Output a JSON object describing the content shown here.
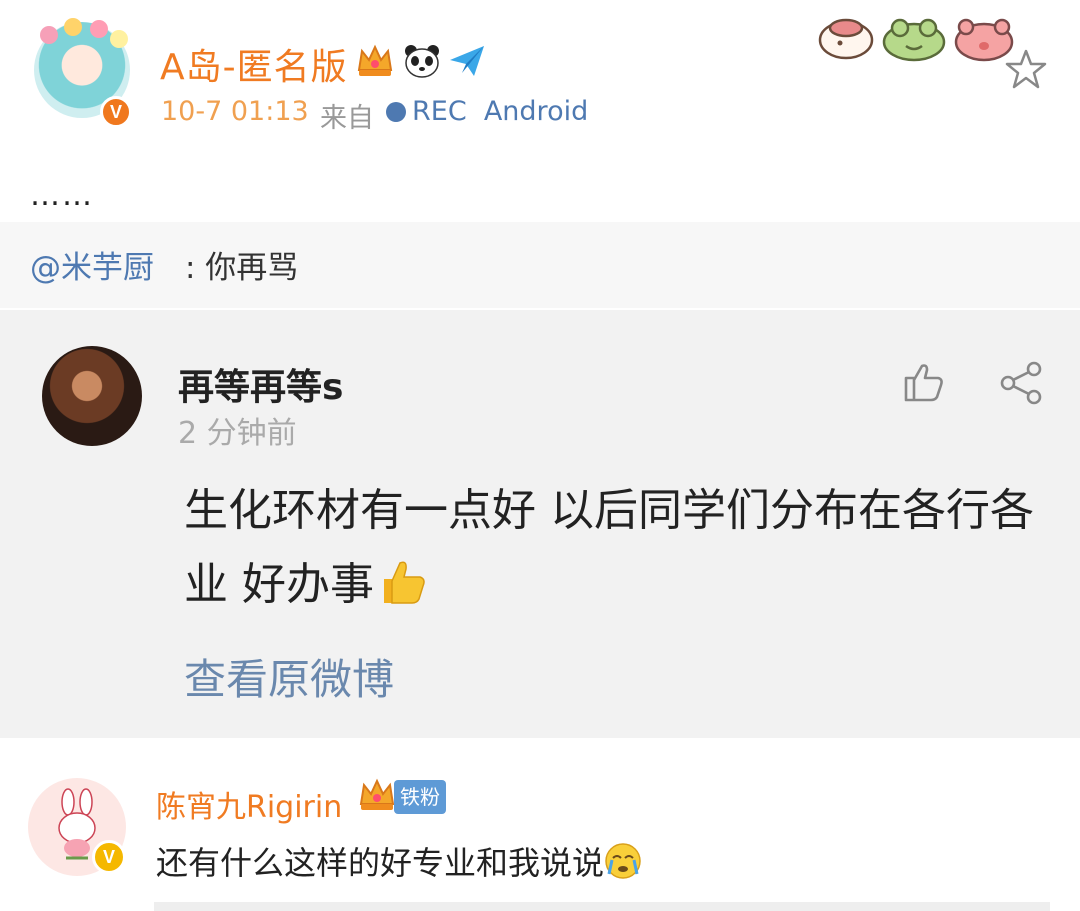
{
  "post": {
    "username": "A岛-匿名版",
    "time": "10-7 01:13",
    "from_label": "来自",
    "source": "REC  Android",
    "text": "……"
  },
  "repost": {
    "mention": "@米芋厨",
    "text": ": 你再骂"
  },
  "card": {
    "name": "再等再等s",
    "time": "2 分钟前",
    "text": "生化环材有一点好 以后同学们分布在各行各业 好办事",
    "link": "查看原微博"
  },
  "comment": {
    "name": "陈宵九Rigirin",
    "fan_badge": "铁粉",
    "text": "还有什么这样的好专业和我说说"
  },
  "colors": {
    "username": "#f07b22",
    "link_blue": "#4e79b1",
    "card_bg": "#f2f2f2"
  },
  "icons": [
    "crown-icon",
    "panda-icon",
    "paper-plane-icon",
    "star-icon",
    "like-icon",
    "share-icon",
    "thumbs-up-emoji",
    "crying-emoji"
  ]
}
